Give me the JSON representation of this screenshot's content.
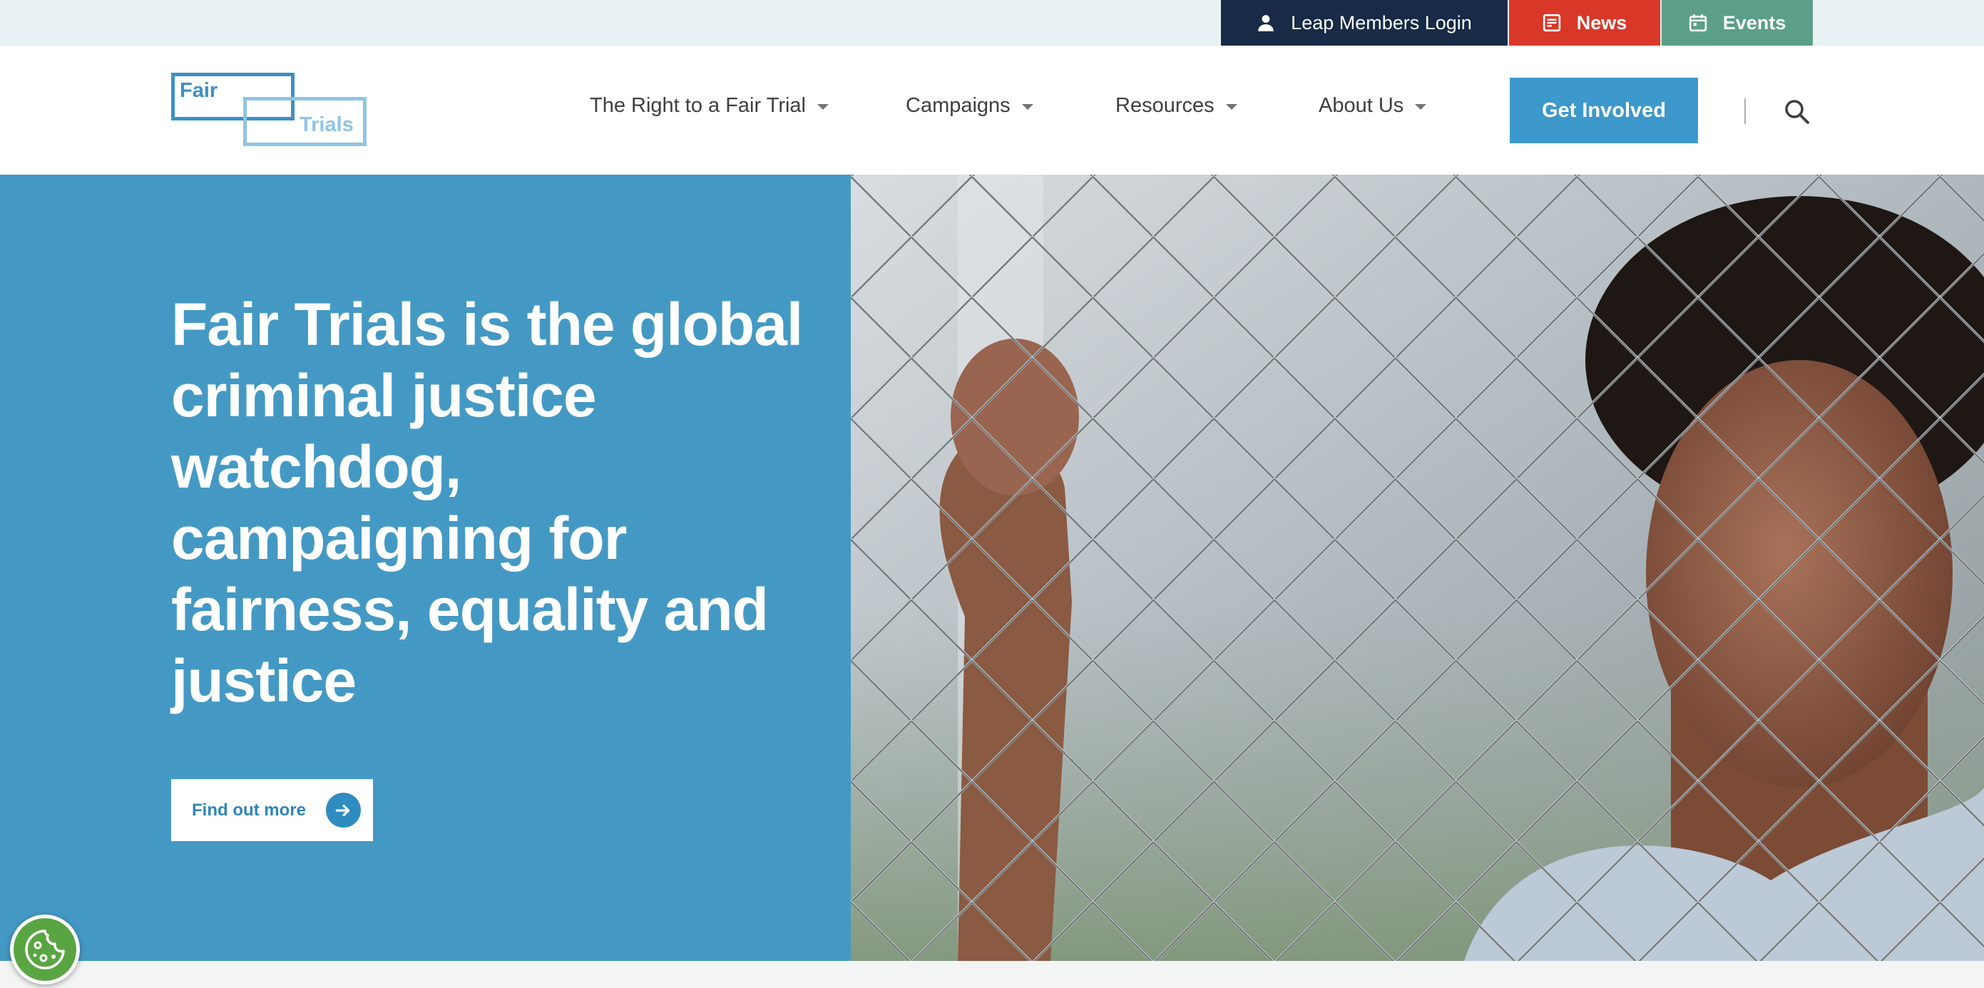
{
  "utility_bar": {
    "login_label": "Leap Members Login",
    "news_label": "News",
    "events_label": "Events"
  },
  "logo": {
    "line1": "Fair",
    "line2": "Trials"
  },
  "nav": {
    "items": [
      {
        "label": "The Right to a Fair Trial"
      },
      {
        "label": "Campaigns"
      },
      {
        "label": "Resources"
      },
      {
        "label": "About Us"
      }
    ],
    "cta_label": "Get Involved"
  },
  "hero": {
    "title": "Fair Trials is the global criminal justice watchdog, campaigning for fairness, equality and justice",
    "button_label": "Find out more"
  },
  "colors": {
    "brand_blue": "#4499c4",
    "login_bg": "#182a46",
    "news_bg": "#d93829",
    "events_bg": "#5c9f88",
    "cta_bg": "#3d98cb",
    "cookie_bg": "#5aa543"
  },
  "icons": [
    "person-icon",
    "news-icon",
    "calendar-icon",
    "caret-down-icon",
    "search-icon",
    "arrow-right-icon",
    "cookie-icon"
  ]
}
